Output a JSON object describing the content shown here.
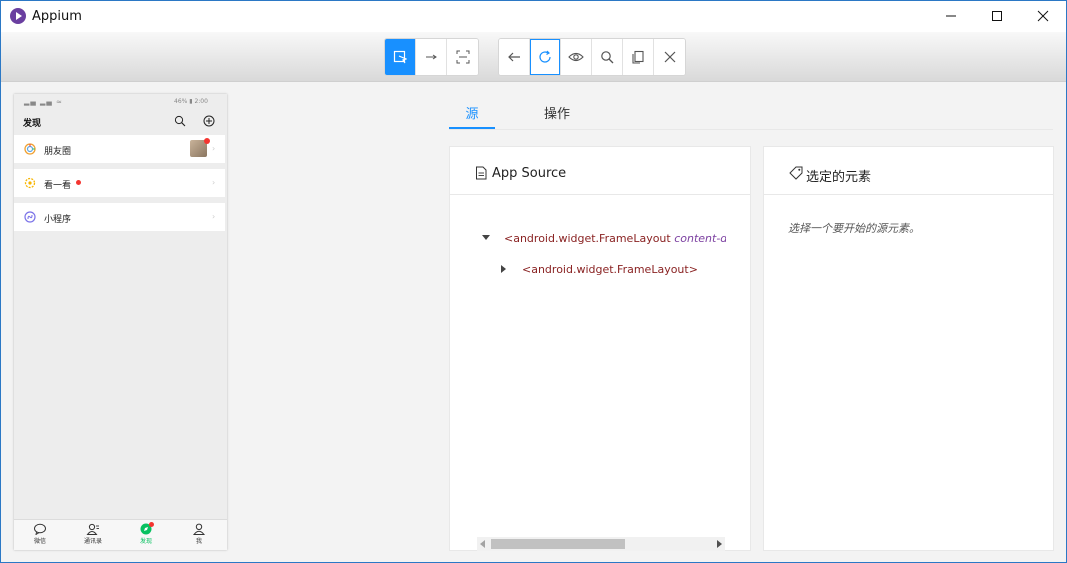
{
  "window": {
    "title": "Appium"
  },
  "toolbar": {
    "left_group": [
      "select-elements",
      "swipe",
      "tap-by-coordinates"
    ],
    "right_group": [
      "back",
      "refresh",
      "show-hide",
      "search",
      "copy-xml",
      "quit"
    ]
  },
  "device": {
    "statusbar_left": "▂▄ ▂▄ ≈",
    "statusbar_right": "46% ▮ 2:00",
    "discover_title": "发现",
    "rows": [
      {
        "label": "朋友圈",
        "icon": "moments-icon"
      },
      {
        "label": "看一看",
        "icon": "top-stories-icon"
      },
      {
        "label": "小程序",
        "icon": "mini-program-icon"
      }
    ],
    "chevron": "›",
    "tabs": [
      {
        "label": "微信"
      },
      {
        "label": "通讯录"
      },
      {
        "label": "发现"
      },
      {
        "label": "我"
      }
    ]
  },
  "tabs": {
    "source": "源",
    "actions": "操作"
  },
  "source_card": {
    "title": "App Source",
    "tree": [
      {
        "tag": "<android.widget.FrameLayout",
        "attr": "content-des",
        "expanded": true
      },
      {
        "tag": "<android.widget.FrameLayout>",
        "attr": "",
        "expanded": false
      }
    ]
  },
  "selected_card": {
    "title": "选定的元素",
    "placeholder": "选择一个要开始的源元素。"
  },
  "colors": {
    "accent": "#1890ff",
    "wechat_green": "#07c160",
    "badge_red": "#f43530",
    "tree_tag": "#8a2323",
    "tree_attr": "#7b3fa0"
  }
}
